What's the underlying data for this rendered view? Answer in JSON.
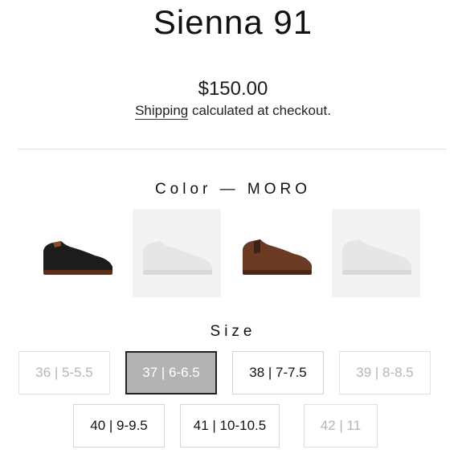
{
  "product": {
    "title": "Sienna 91",
    "price": "$150.00",
    "shipping_link": "Shipping",
    "shipping_rest": " calculated at checkout."
  },
  "color": {
    "label": "Color",
    "separator": "—",
    "selected": "MORO",
    "swatches": [
      {
        "name": "black",
        "color": "#1c1c1c",
        "available": true
      },
      {
        "name": "white",
        "color": "#e9e9e9",
        "available": false
      },
      {
        "name": "moro",
        "color": "#6b3a22",
        "available": true
      },
      {
        "name": "white-2",
        "color": "#e9e9e9",
        "available": false
      }
    ]
  },
  "size": {
    "label": "Size",
    "options": [
      {
        "label": "36 | 5-5.5",
        "state": "unavailable"
      },
      {
        "label": "37 | 6-6.5",
        "state": "selected"
      },
      {
        "label": "38 | 7-7.5",
        "state": "available"
      },
      {
        "label": "39 | 8-8.5",
        "state": "unavailable"
      },
      {
        "label": "40 | 9-9.5",
        "state": "available"
      },
      {
        "label": "41 | 10-10.5",
        "state": "available"
      },
      {
        "label": "42 | 11",
        "state": "unavailable"
      }
    ]
  }
}
